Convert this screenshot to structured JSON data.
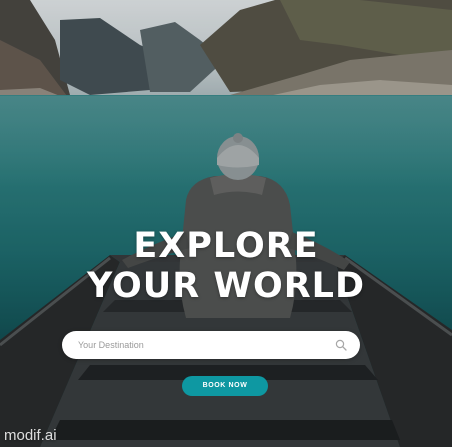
{
  "hero": {
    "headline_line1": "EXPLORE",
    "headline_line2": "YOUR WORLD"
  },
  "search": {
    "placeholder": "Your Destination",
    "value": "",
    "icon": "search-icon"
  },
  "cta": {
    "label": "BOOK NOW",
    "color": "#0e98a2"
  },
  "watermark": {
    "text": "modif.ai"
  },
  "colors": {
    "accent": "#0e98a2",
    "headline": "#ffffff"
  }
}
